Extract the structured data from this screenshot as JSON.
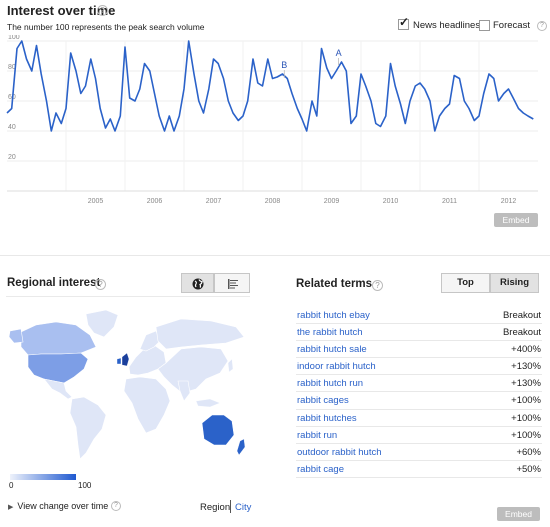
{
  "interest_over_time": {
    "title": "Interest over time",
    "subtitle": "The number 100 represents the peak search volume",
    "news_headlines_label": "News headlines",
    "news_headlines_checked": true,
    "forecast_label": "Forecast",
    "forecast_checked": false,
    "embed_label": "Embed",
    "help_glyph": "?",
    "check_glyph": "✓"
  },
  "chart_data": {
    "type": "line",
    "x_labels": [
      "2005",
      "2006",
      "2007",
      "2008",
      "2009",
      "2010",
      "2011",
      "2012"
    ],
    "y_ticks": [
      20,
      40,
      60,
      80,
      100
    ],
    "ylim": [
      0,
      100
    ],
    "x_start": 2004.0,
    "x_end": 2013.0,
    "line_color": "#2b62c9",
    "grid": true,
    "annotations": [
      {
        "label": "B",
        "x": 2008.7,
        "y": 78
      },
      {
        "label": "A",
        "x": 2009.62,
        "y": 86
      }
    ],
    "series": [
      {
        "x": [
          2004.0,
          2004.08,
          2004.17,
          2004.25,
          2004.33,
          2004.42,
          2004.5,
          2004.58,
          2004.67,
          2004.75,
          2004.83,
          2004.92,
          2005.0,
          2005.08,
          2005.17,
          2005.25,
          2005.33,
          2005.42,
          2005.5,
          2005.58,
          2005.67,
          2005.75,
          2005.83,
          2005.92,
          2006.0,
          2006.08,
          2006.17,
          2006.25,
          2006.33,
          2006.42,
          2006.5,
          2006.58,
          2006.67,
          2006.75,
          2006.83,
          2006.92,
          2007.0,
          2007.08,
          2007.17,
          2007.25,
          2007.33,
          2007.42,
          2007.5,
          2007.58,
          2007.67,
          2007.75,
          2007.83,
          2007.92,
          2008.0,
          2008.08,
          2008.17,
          2008.25,
          2008.33,
          2008.42,
          2008.5,
          2008.58,
          2008.67,
          2008.75,
          2008.83,
          2008.92,
          2009.0,
          2009.08,
          2009.17,
          2009.25,
          2009.33,
          2009.42,
          2009.5,
          2009.58,
          2009.67,
          2009.75,
          2009.83,
          2009.92,
          2010.0,
          2010.08,
          2010.17,
          2010.25,
          2010.33,
          2010.42,
          2010.5,
          2010.58,
          2010.67,
          2010.75,
          2010.83,
          2010.92,
          2011.0,
          2011.08,
          2011.17,
          2011.25,
          2011.33,
          2011.42,
          2011.5,
          2011.58,
          2011.67,
          2011.75,
          2011.83,
          2011.92,
          2012.0,
          2012.08,
          2012.17,
          2012.25,
          2012.33,
          2012.42,
          2012.5,
          2012.58,
          2012.67,
          2012.75,
          2012.83,
          2012.92
        ],
        "y": [
          52,
          55,
          95,
          100,
          88,
          80,
          97,
          78,
          60,
          40,
          52,
          45,
          55,
          92,
          80,
          65,
          70,
          88,
          75,
          55,
          42,
          48,
          40,
          50,
          96,
          62,
          60,
          68,
          85,
          80,
          65,
          50,
          40,
          50,
          40,
          50,
          68,
          100,
          78,
          60,
          52,
          68,
          88,
          85,
          75,
          60,
          52,
          47,
          50,
          60,
          88,
          72,
          70,
          88,
          75,
          76,
          78,
          75,
          65,
          55,
          48,
          40,
          60,
          50,
          95,
          82,
          75,
          80,
          86,
          80,
          45,
          50,
          78,
          70,
          60,
          45,
          43,
          50,
          85,
          70,
          58,
          45,
          60,
          70,
          72,
          68,
          60,
          40,
          50,
          55,
          58,
          77,
          75,
          60,
          55,
          47,
          50,
          65,
          78,
          75,
          60,
          65,
          68,
          62,
          55,
          52,
          50,
          48
        ]
      }
    ]
  },
  "regional_interest": {
    "title": "Regional interest",
    "help_glyph": "?",
    "map_toggle_icon": "globe-icon",
    "list_toggle_icon": "list-icon",
    "legend_min": "0",
    "legend_max": "100",
    "view_change_label": "View change over time",
    "region_label": "Region",
    "city_label": "City",
    "colors": {
      "low": "#dfe6f7",
      "mid": "#a9bff0",
      "high": "#2b62c9",
      "peak": "#1a3f9c"
    }
  },
  "related_terms": {
    "title": "Related terms",
    "help_glyph": "?",
    "top_tab": "Top",
    "rising_tab": "Rising",
    "active_tab": "Rising",
    "items": [
      {
        "term": "rabbit hutch ebay",
        "value": "Breakout"
      },
      {
        "term": "the rabbit hutch",
        "value": "Breakout"
      },
      {
        "term": "rabbit hutch sale",
        "value": "+400%"
      },
      {
        "term": "indoor rabbit hutch",
        "value": "+130%"
      },
      {
        "term": "rabbit hutch run",
        "value": "+130%"
      },
      {
        "term": "rabbit cages",
        "value": "+100%"
      },
      {
        "term": "rabbit hutches",
        "value": "+100%"
      },
      {
        "term": "rabbit run",
        "value": "+100%"
      },
      {
        "term": "outdoor rabbit hutch",
        "value": "+60%"
      },
      {
        "term": "rabbit cage",
        "value": "+50%"
      }
    ],
    "embed_label": "Embed"
  }
}
